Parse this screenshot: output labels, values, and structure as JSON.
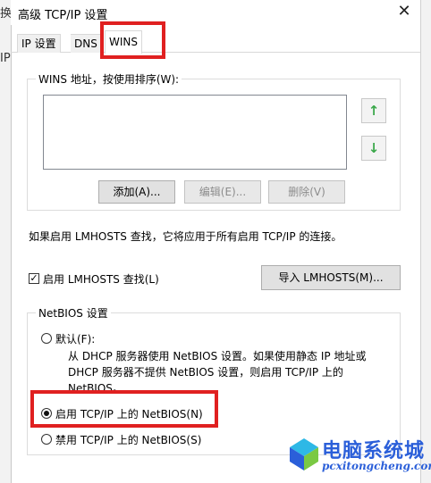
{
  "window": {
    "title": "高级 TCP/IP 设置",
    "close_glyph": "✕"
  },
  "background_glyphs": {
    "left_top": "换",
    "left_mid": "IP"
  },
  "tabs": [
    {
      "label": "IP 设置"
    },
    {
      "label": "DNS"
    },
    {
      "label": "WINS"
    }
  ],
  "wins": {
    "group_label": "WINS 地址，按使用排序(W):",
    "up_arrow": "↑",
    "down_arrow": "↓",
    "buttons": {
      "add": "添加(A)...",
      "edit": "编辑(E)...",
      "remove": "删除(V)"
    }
  },
  "lmhosts": {
    "info_text": "如果启用 LMHOSTS 查找，它将应用于所有启用 TCP/IP 的连接。",
    "checkbox_label": "启用 LMHOSTS 查找(L)",
    "checkbox_checked": true,
    "checkbox_glyph": "✓",
    "import_button": "导入 LMHOSTS(M)..."
  },
  "netbios": {
    "group_label": "NetBIOS 设置",
    "options": [
      {
        "label": "默认(F):",
        "selected": false
      },
      {
        "label": "启用 TCP/IP 上的 NetBIOS(N)",
        "selected": true
      },
      {
        "label": "禁用 TCP/IP 上的 NetBIOS(S)",
        "selected": false
      }
    ],
    "default_desc_1": "从 DHCP 服务器使用 NetBIOS 设置。如果使用静态 IP 地址或",
    "default_desc_2": "DHCP 服务器不提供 NetBIOS 设置，则启用 TCP/IP 上的",
    "default_desc_3": "NetBIOS。"
  },
  "watermark": {
    "title": "电脑系统城",
    "url": "pcxitongcheng.com"
  },
  "colors": {
    "highlight_red": "#e02020",
    "arrow_green": "#3aa84a",
    "watermark_blue": "#2b5fd9"
  }
}
